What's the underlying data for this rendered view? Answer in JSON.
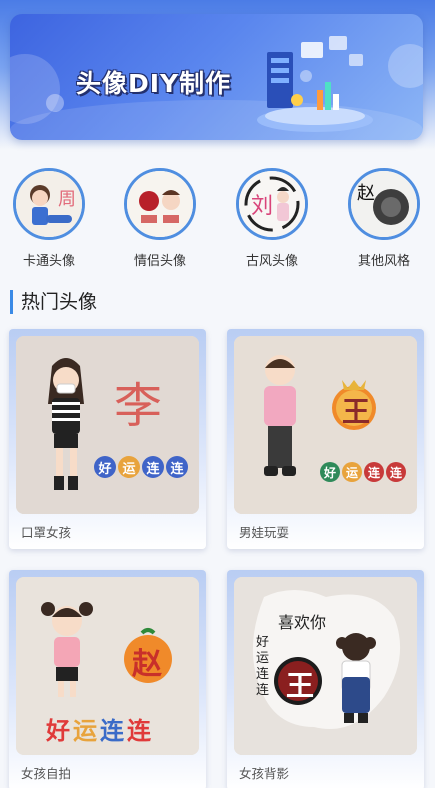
{
  "banner": {
    "title": "头像DIY制作",
    "colors": {
      "primary": "#3d64e0",
      "light": "#8db6f6"
    }
  },
  "categories": [
    {
      "label": "卡通头像",
      "icon": "cartoon-avatar-image"
    },
    {
      "label": "情侣头像",
      "icon": "couple-avatar-image"
    },
    {
      "label": "古风头像",
      "icon": "ancient-style-avatar-image"
    },
    {
      "label": "其他风格",
      "icon": "other-style-avatar-image"
    }
  ],
  "section": {
    "title": "热门头像",
    "accent": "#3a8ae6"
  },
  "cards": [
    {
      "caption": "口罩女孩",
      "surname": "李",
      "blessing": [
        "好",
        "运",
        "连",
        "连"
      ]
    },
    {
      "caption": "男娃玩耍",
      "surname": "王",
      "blessing": [
        "好",
        "运",
        "连",
        "连"
      ]
    },
    {
      "caption": "女孩自拍",
      "surname": "赵",
      "blessing": [
        "好",
        "运",
        "连",
        "连"
      ]
    },
    {
      "caption": "女孩背影",
      "surname": "王",
      "blessing": [
        "好",
        "运",
        "连",
        "连"
      ],
      "handwriting": "喜欢你"
    }
  ]
}
